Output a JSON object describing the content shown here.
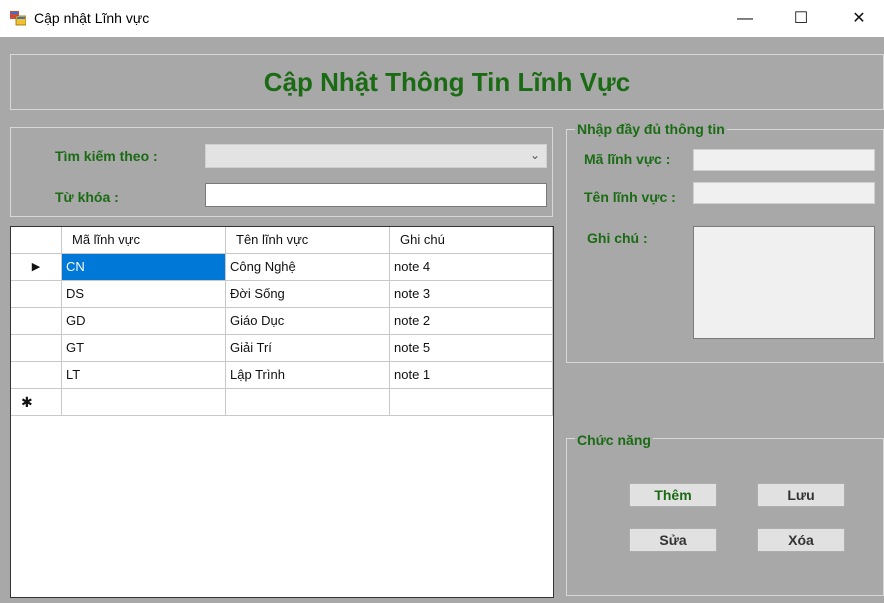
{
  "window": {
    "title": "Cập nhật Lĩnh vực",
    "minimize_glyph": "—",
    "maximize_glyph": "☐",
    "close_glyph": "✕"
  },
  "header": {
    "title": "Cập Nhật Thông Tin Lĩnh Vực"
  },
  "search": {
    "search_by_label": "Tìm kiếm theo :",
    "combo_value": "",
    "keyword_label": "Từ khóa :",
    "keyword_value": ""
  },
  "grid": {
    "columns": [
      "Mã lĩnh vực",
      "Tên lĩnh vực",
      "Ghi chú"
    ],
    "rows": [
      [
        "CN",
        "Công Nghệ",
        "note 4"
      ],
      [
        "DS",
        "Đời Sống",
        "note 3"
      ],
      [
        "GD",
        "Giáo Dục",
        "note 2"
      ],
      [
        "GT",
        "Giải Trí",
        "note 5"
      ],
      [
        "LT",
        "Lập Trình",
        "note 1"
      ]
    ],
    "current_row_glyph": "▶",
    "new_row_glyph": "✱"
  },
  "detail": {
    "group_title": "Nhập đầy đủ thông tin",
    "code_label": "Mã lĩnh vực :",
    "name_label": "Tên lĩnh vực :",
    "note_label": "Ghi chú :",
    "code_value": "",
    "name_value": "",
    "note_value": ""
  },
  "actions": {
    "group_title": "Chức năng",
    "add": "Thêm",
    "save": "Lưu",
    "edit": "Sửa",
    "delete": "Xóa"
  },
  "colors": {
    "accent_green": "#1a6b14",
    "form_bg": "#a8a8a8",
    "selection_blue": "#0078d7"
  },
  "icons": {
    "app": "winform-app-icon",
    "current_row": "row-indicator-icon",
    "new_row": "new-row-icon"
  }
}
